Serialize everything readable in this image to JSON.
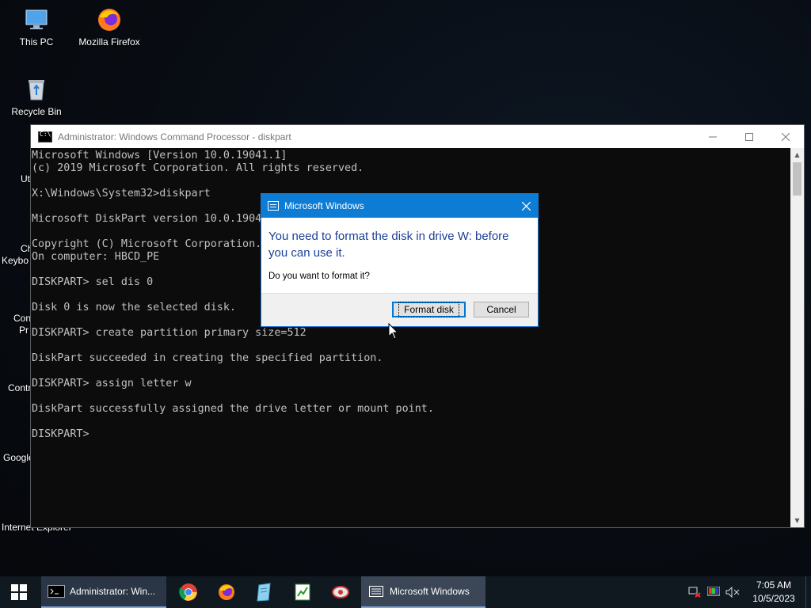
{
  "desktop": {
    "icons": [
      {
        "label": "This PC"
      },
      {
        "label": "Mozilla Firefox"
      },
      {
        "label": "Recycle Bin"
      }
    ],
    "partial_labels": [
      "Ut",
      "Ch",
      "Keybo",
      "Con",
      "Pr",
      "Contr",
      "Google",
      "Internet Explorer"
    ]
  },
  "cmd_window": {
    "title": "Administrator: Windows Command Processor - diskpart",
    "lines": [
      "Microsoft Windows [Version 10.0.19041.1]",
      "(c) 2019 Microsoft Corporation. All rights reserved.",
      "",
      "X:\\Windows\\System32>diskpart",
      "",
      "Microsoft DiskPart version 10.0.1904",
      "",
      "Copyright (C) Microsoft Corporation.",
      "On computer: HBCD_PE",
      "",
      "DISKPART> sel dis 0",
      "",
      "Disk 0 is now the selected disk.",
      "",
      "DISKPART> create partition primary size=512",
      "",
      "DiskPart succeeded in creating the specified partition.",
      "",
      "DISKPART> assign letter w",
      "",
      "DiskPart successfully assigned the drive letter or mount point.",
      "",
      "DISKPART> "
    ]
  },
  "dialog": {
    "title": "Microsoft Windows",
    "heading": "You need to format the disk in drive W: before you can use it.",
    "question": "Do you want to format it?",
    "primary_button": "Format disk",
    "cancel_button": "Cancel"
  },
  "taskbar": {
    "apps": [
      {
        "label": "Administrator: Win..."
      },
      {
        "label": "Microsoft Windows"
      }
    ],
    "pinned_icons": [
      "chrome-icon",
      "firefox-icon",
      "notepad-icon",
      "spreadsheet-icon",
      "network-tool-icon"
    ],
    "clock": {
      "time": "7:05 AM",
      "date": "10/5/2023"
    }
  }
}
